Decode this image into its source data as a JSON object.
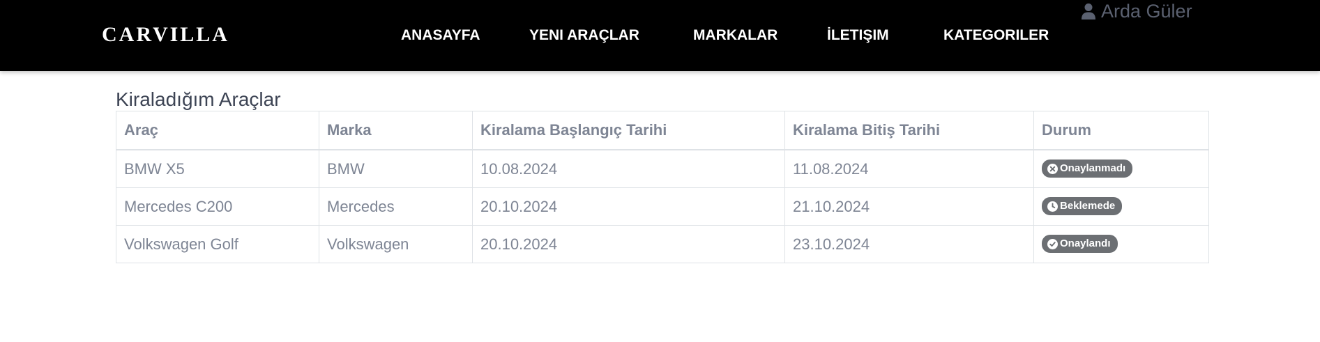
{
  "navbar": {
    "brand": "CARVILLA",
    "links": [
      "ANASAYFA",
      "YENI ARAÇLAR",
      "MARKALAR",
      "İLETIŞIM",
      "KATEGORILER"
    ],
    "user_name": "Arda Güler"
  },
  "main": {
    "title": "Kiraladığım Araçlar",
    "table": {
      "headers": [
        "Araç",
        "Marka",
        "Kiralama Başlangıç Tarihi",
        "Kiralama Bitiş Tarihi",
        "Durum"
      ],
      "rows": [
        {
          "car": "BMW X5",
          "brand": "BMW",
          "start": "10.08.2024",
          "end": "11.08.2024",
          "status": "Onaylanmadı",
          "status_icon": "x-circle-icon"
        },
        {
          "car": "Mercedes C200",
          "brand": "Mercedes",
          "start": "20.10.2024",
          "end": "21.10.2024",
          "status": "Beklemede",
          "status_icon": "clock-icon"
        },
        {
          "car": "Volkswagen Golf",
          "brand": "Volkswagen",
          "start": "20.10.2024",
          "end": "23.10.2024",
          "status": "Onaylandı",
          "status_icon": "check-circle-icon"
        }
      ]
    }
  },
  "colors": {
    "navbar_bg": "#000000",
    "text_muted": "#7e8594",
    "badge_bg": "#6c6f73",
    "user_text": "#5b6170"
  }
}
